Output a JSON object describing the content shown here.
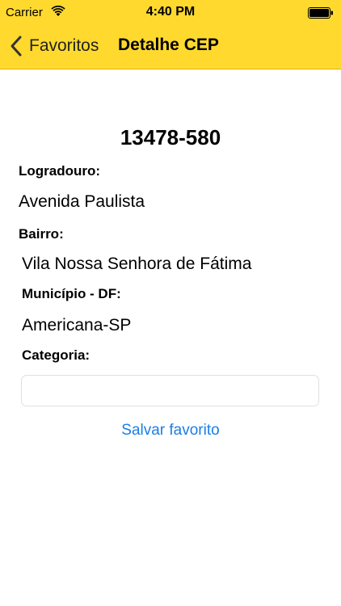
{
  "status_bar": {
    "carrier": "Carrier",
    "time": "4:40 PM"
  },
  "nav": {
    "back_label": "Favoritos",
    "title": "Detalhe CEP"
  },
  "detail": {
    "cep": "13478-580",
    "logradouro_label": "Logradouro:",
    "logradouro_value": "Avenida Paulista",
    "bairro_label": "Bairro:",
    "bairro_value": "Vila Nossa Senhora de Fátima",
    "municipio_label": "Município - DF:",
    "municipio_value": "Americana-SP",
    "categoria_label": "Categoria:",
    "categoria_value": "",
    "categoria_placeholder": ""
  },
  "actions": {
    "save_label": "Salvar favorito"
  },
  "colors": {
    "nav_background": "#FFD92E",
    "link": "#1a7ee8"
  }
}
